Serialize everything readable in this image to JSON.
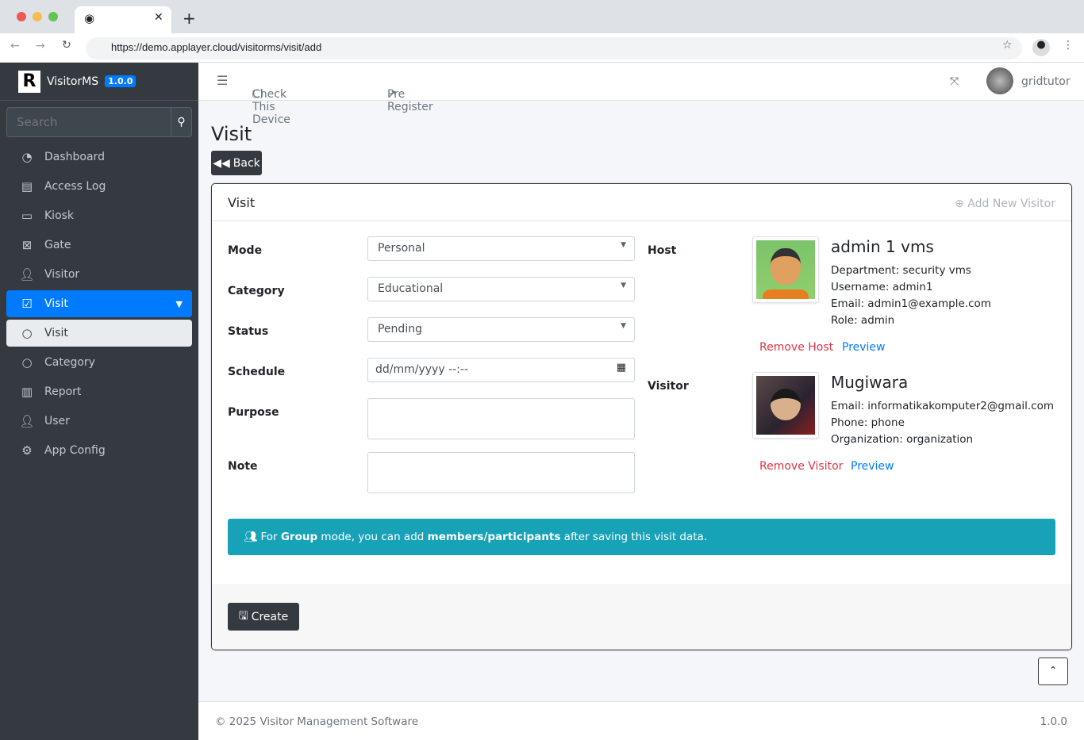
{
  "browser": {
    "url": "https://demo.applayer.cloud/visitorms/visit/add"
  },
  "brand": {
    "logo": "R",
    "name": "VisitorMS",
    "version": "1.0.0"
  },
  "sidebar": {
    "search_placeholder": "Search",
    "items": [
      {
        "label": "Dashboard",
        "icon": "tachometer-icon"
      },
      {
        "label": "Access Log",
        "icon": "file-icon"
      },
      {
        "label": "Kiosk",
        "icon": "desktop-icon"
      },
      {
        "label": "Gate",
        "icon": "x-square-icon"
      },
      {
        "label": "Visitor",
        "icon": "user-icon"
      },
      {
        "label": "Visit",
        "icon": "calendar-check-icon",
        "active": true
      },
      {
        "label": "Visit",
        "icon": "circle-icon",
        "sub": true
      },
      {
        "label": "Category",
        "icon": "circle-icon"
      },
      {
        "label": "Report",
        "icon": "chart-bar-icon"
      },
      {
        "label": "User",
        "icon": "user-tie-icon"
      },
      {
        "label": "App Config",
        "icon": "cogs-icon"
      }
    ]
  },
  "navbar": {
    "check_device": "Check This Device",
    "pre_register": "Pre Register",
    "username": "gridtutor"
  },
  "page": {
    "title": "Visit",
    "back": "Back"
  },
  "card": {
    "title": "Visit",
    "add_new_visitor": "Add New Visitor",
    "fields": {
      "mode_label": "Mode",
      "mode_value": "Personal",
      "category_label": "Category",
      "category_value": "Educational",
      "status_label": "Status",
      "status_value": "Pending",
      "schedule_label": "Schedule",
      "schedule_placeholder": "dd/mm/yyyy --:--",
      "purpose_label": "Purpose",
      "note_label": "Note"
    },
    "host": {
      "label": "Host",
      "name": "admin 1 vms",
      "department": "Department: security vms",
      "username": "Username: admin1",
      "email": "Email: admin1@example.com",
      "role": "Role: admin",
      "remove": "Remove Host",
      "preview": "Preview"
    },
    "visitor": {
      "label": "Visitor",
      "name": "Mugiwara",
      "email": "Email: informatikakomputer2@gmail.com",
      "phone": "Phone: phone",
      "organization": "Organization: organization",
      "remove": "Remove Visitor",
      "preview": "Preview"
    },
    "alert": {
      "pre": "For ",
      "group": "Group",
      "mid": " mode, you can add ",
      "members": "members/participants",
      "post": " after saving this visit data."
    },
    "create": "Create"
  },
  "footer": {
    "copyright": "© 2025 Visitor Management Software",
    "version": "1.0.0"
  }
}
